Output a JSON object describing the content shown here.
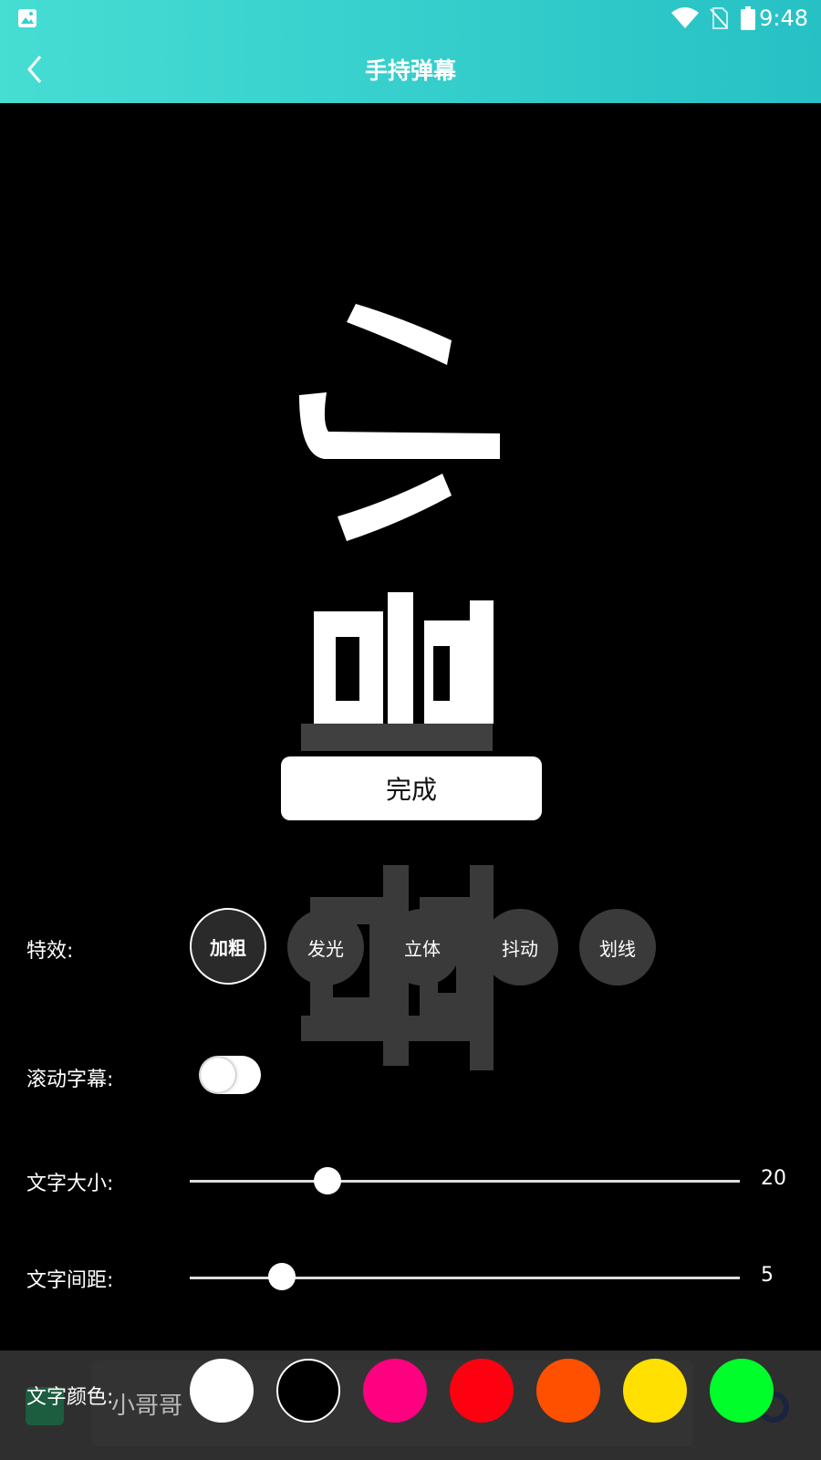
{
  "status": {
    "time": "9:48"
  },
  "header": {
    "title": "手持弹幕"
  },
  "preview": {
    "text": "小哥哥"
  },
  "done_button": "完成",
  "effects": {
    "label": "特效:",
    "items": [
      "加粗",
      "发光",
      "立体",
      "抖动",
      "划线"
    ],
    "selected": "加粗"
  },
  "scroll": {
    "label": "滚动字幕:",
    "enabled": false
  },
  "size": {
    "label": "文字大小:",
    "value": "20"
  },
  "spacing": {
    "label": "文字间距:",
    "value": "5"
  },
  "color": {
    "label": "文字颜色:",
    "swatches": [
      "#ffffff",
      "#000000",
      "#ff0080",
      "#ff0010",
      "#ff5000",
      "#ffe000",
      "#00ff2a"
    ]
  },
  "input": {
    "value": "小哥哥"
  },
  "colors": {
    "appbar_start": "#46ddd3",
    "appbar_end": "#27c1c5"
  }
}
